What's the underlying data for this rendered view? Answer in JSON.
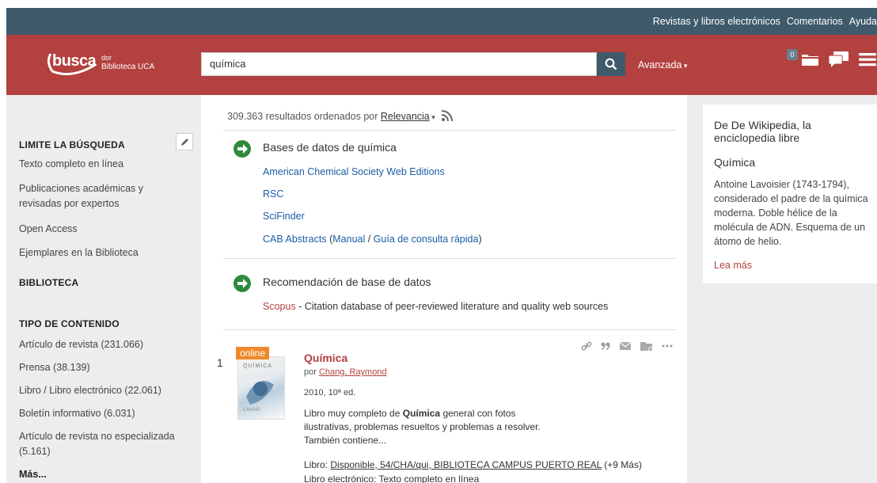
{
  "topbar": {
    "links": [
      "Revistas y libros electrónicos",
      "Comentarios",
      "Ayuda"
    ]
  },
  "logo": {
    "main": "busca",
    "suffix": "dor",
    "sub": "Biblioteca UCA"
  },
  "search": {
    "query": "química",
    "advanced_label": "Avanzada"
  },
  "header": {
    "badge_count": "0"
  },
  "sidebar": {
    "limit_heading": "LIMITE LA BÚSQUEDA",
    "limit_items": [
      "Texto completo en línea",
      "Publicaciones académicas y revisadas por expertos",
      "Open Access",
      "Ejemplares en la Biblioteca"
    ],
    "library_heading": "BIBLIOTECA",
    "content_heading": "TIPO DE CONTENIDO",
    "content_items": [
      "Artículo de revista (231.066)",
      "Prensa (38.139)",
      "Libro / Libro electrónico (22.061)",
      "Boletín informativo (6.031)",
      "Artículo de revista no especializada (5.161)"
    ],
    "more": "Más..."
  },
  "results": {
    "count_text": "309.363 resultados ordenados por",
    "sort_label": "Relevancia"
  },
  "databases": {
    "title": "Bases de datos de química",
    "links": [
      "American Chemical Society Web Editions",
      "RSC",
      "SciFinder"
    ],
    "cab_link": "CAB Abstracts",
    "cab_open": "(",
    "cab_manual": "Manual",
    "cab_sep": "/",
    "cab_guide": "Guía de consulta rápida",
    "cab_close": ")"
  },
  "recommendation": {
    "title": "Recomendación de base de datos",
    "link": "Scopus",
    "desc": "- Citation database of peer-reviewed literature and quality web sources"
  },
  "result1": {
    "num": "1",
    "badge": "online",
    "title": "Química",
    "by": "por",
    "author": "Chang, Raymond",
    "edition": "2010, 10ª ed.",
    "desc_pre": "Libro muy completo de",
    "desc_bold": "Química",
    "desc_post": "general con fotos ilustrativas, problemas resueltos y problemas a resolver. También contiene...",
    "avail_label": "Libro:",
    "avail_link": "Disponible, 54/CHA/qui, BIBLIOTECA CAMPUS PUERTO REAL",
    "avail_more": "(+9 Más)",
    "ebook": "Libro electrónico: Texto completo en línea",
    "cover_title": "QUÍMICA",
    "cover_author": "CHANG"
  },
  "wiki": {
    "source": "De De Wikipedia, la enciclopedia libre",
    "title": "Química",
    "text": "Antoine Lavoisier (1743-1794), considerado el padre de la química moderna. Doble hélice de la molécula de ADN. Esquema de un átomo de helio.",
    "more": "Lea más"
  }
}
